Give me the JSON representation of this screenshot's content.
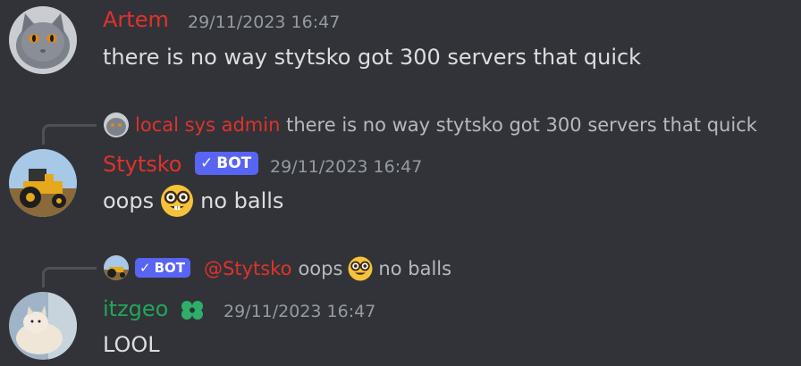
{
  "colors": {
    "background": "#313338",
    "red_name": "#e0322b",
    "green_name": "#23a55a",
    "bot_tag": "#5865f2",
    "timestamp": "#949ba4"
  },
  "messages": [
    {
      "author": "Artem",
      "timestamp": "29/11/2023 16:47",
      "content": "there is no way stytsko got 300 servers that quick",
      "avatar": "cat-avatar"
    },
    {
      "reply": {
        "author": "local sys admin",
        "content": "there is no way stytsko got 300 servers that quick"
      },
      "author": "Stytsko",
      "bot_tag": "BOT",
      "timestamp": "29/11/2023 16:47",
      "content_before_emoji": "oops",
      "emoji": "nerd-face",
      "content_after_emoji": "no balls",
      "avatar": "tractor-avatar"
    },
    {
      "reply": {
        "bot_tag": "BOT",
        "mention": "@Stytsko",
        "content_before_emoji": "oops",
        "emoji": "nerd-face",
        "content_after_emoji": "no balls"
      },
      "author": "itzgeo",
      "role_icon": "clover-icon",
      "timestamp": "29/11/2023 16:47",
      "content": "LOOL",
      "avatar": "dog-avatar"
    }
  ]
}
